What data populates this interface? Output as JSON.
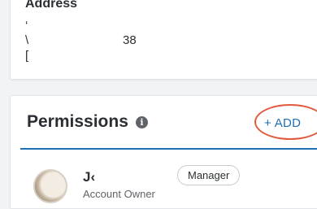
{
  "address": {
    "heading": "Address",
    "lines": [
      "‘",
      "\\",
      "["
    ],
    "line2_tail": "38"
  },
  "permissions": {
    "title": "Permissions",
    "info_icon": "info-icon",
    "add_label": "+ ADD",
    "annotation_color": "#e25a3d",
    "accent_color": "#1f6fb3",
    "members": [
      {
        "name": "J‹",
        "role_text": "Account Owner",
        "badge": "Manager"
      }
    ]
  }
}
